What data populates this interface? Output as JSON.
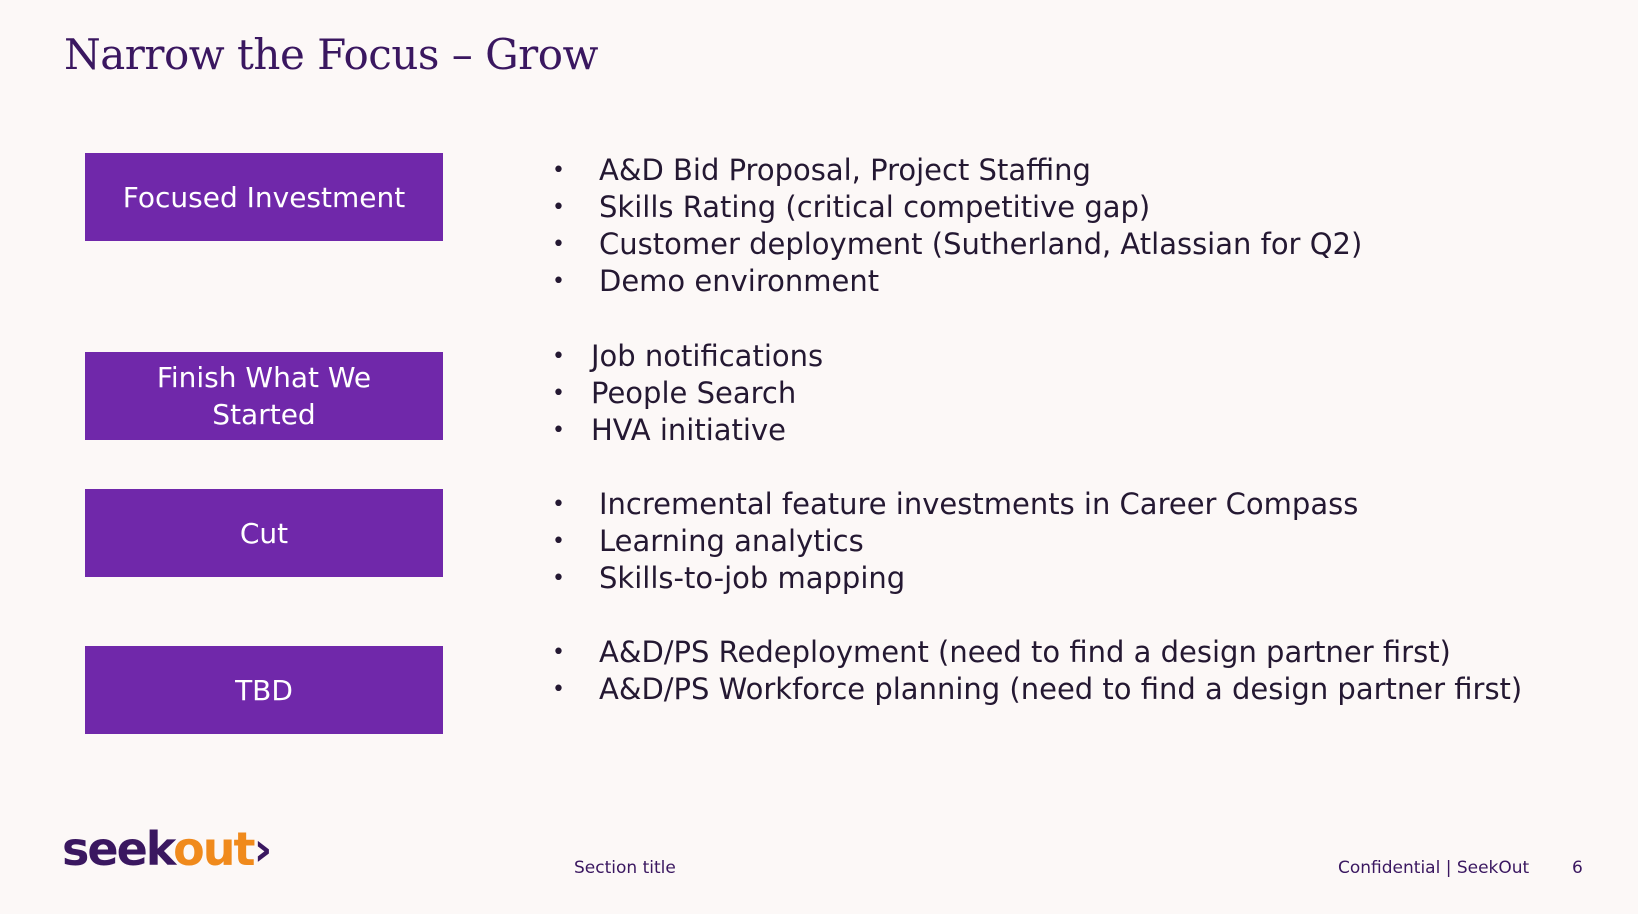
{
  "slide": {
    "title": "Narrow the Focus – Grow"
  },
  "groups": [
    {
      "label": "Focused Investment",
      "items": [
        "A&D Bid Proposal, Project Staffing",
        "Skills Rating (critical competitive gap)",
        "Customer deployment (Sutherland, Atlassian for Q2)",
        "Demo environment"
      ]
    },
    {
      "label": "Finish What We Started",
      "items": [
        "Job notifications",
        "People Search",
        "HVA initiative"
      ]
    },
    {
      "label": "Cut",
      "items": [
        "Incremental feature investments in Career Compass",
        "Learning analytics",
        "Skills-to-job mapping"
      ]
    },
    {
      "label": "TBD",
      "items": [
        "A&D/PS Redeployment (need to find a design partner first)",
        "A&D/PS Workforce planning (need to find a design partner first)"
      ]
    }
  ],
  "bullet_glyph": "•",
  "footer": {
    "logo_seek": "seek",
    "logo_out": "out",
    "logo_chevron": "›",
    "section": "Section title",
    "confidential": "Confidential | SeekOut",
    "page_number": "6"
  },
  "colors": {
    "background": "#fcf8f7",
    "label_box": "#7028aa",
    "title": "#3a1760",
    "logo_accent": "#f08a1c"
  }
}
